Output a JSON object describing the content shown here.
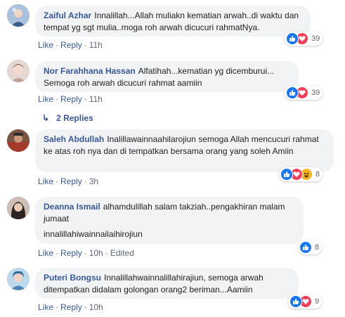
{
  "comments": [
    {
      "author": "Zaiful Azhar",
      "text": "Innalillah...Allah muliakn kematian arwah..di waktu dan tempat yg sgt mulia..moga roh arwah dicucuri rahmatNya.",
      "like": "Like",
      "reply": "Reply",
      "time": "11h",
      "edited": "",
      "reactions": [
        "like",
        "love"
      ],
      "count": "39",
      "avatar_color": "#8aa7c9"
    },
    {
      "author": "Nor Farahhana Hassan",
      "text": "Alfatihah...kematian yg dicemburui... Semoga roh arwah dicucuri rahmat aamiin",
      "like": "Like",
      "reply": "Reply",
      "time": "11h",
      "edited": "",
      "reactions": [
        "like",
        "love"
      ],
      "count": "39",
      "avatar_color": "#d8c9c2"
    },
    {
      "author": "Saleh Abdullah",
      "text": "Inalillawainnaahilarojiun semoga Allah mencucuri rahmat ke atas roh nya dan di tempatkan bersama orang yang soleh Amiin",
      "like": "Like",
      "reply": "Reply",
      "time": "3h",
      "edited": "",
      "reactions": [
        "like",
        "love",
        "haha"
      ],
      "count": "8",
      "avatar_color": "#6b4a3a"
    },
    {
      "author": "Deanna Ismail",
      "text": "alhamdulillah salam takziah..pengakhiran malam jumaat",
      "text2": "innalillahiwainnailaihirojiun",
      "like": "Like",
      "reply": "Reply",
      "time": "10h",
      "edited": "Edited",
      "reactions": [
        "like"
      ],
      "count": "8",
      "avatar_color": "#5c4a45"
    },
    {
      "author": "Puteri Bongsu",
      "text": "Innalillahwainnalillahirajiun, semoga arwah ditempatkan didalam golongan orang2 beriman...Aamiin",
      "like": "Like",
      "reply": "Reply",
      "time": "10h",
      "edited": "",
      "reactions": [
        "like",
        "love"
      ],
      "count": "9",
      "avatar_color": "#7fb2d6"
    }
  ],
  "replies_link": {
    "arrow": "↳",
    "label": "2 Replies"
  },
  "colors": {
    "link": "#385898",
    "bubble": "#f2f3f5",
    "like": "#1877f2",
    "love": "#f33e58",
    "haha": "#f7b125"
  }
}
